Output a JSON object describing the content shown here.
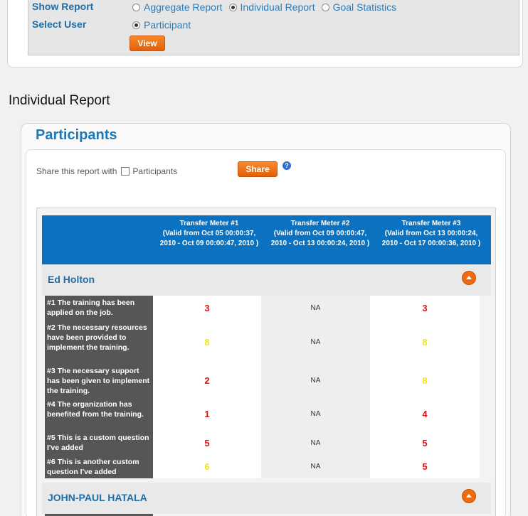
{
  "filters": {
    "show_report_label": "Show Report",
    "select_user_label": "Select User",
    "report_options": [
      {
        "label": "Aggregate Report",
        "checked": false
      },
      {
        "label": "Individual Report",
        "checked": true
      },
      {
        "label": "Goal Statistics",
        "checked": false
      }
    ],
    "user_options": [
      {
        "label": "Participant",
        "checked": true
      }
    ],
    "view_button": "View"
  },
  "report_title": "Individual Report",
  "panel": {
    "title": "Participants",
    "share_label": "Share this report with",
    "share_checkbox_label": "Participants",
    "share_button": "Share",
    "help_icon": "?"
  },
  "columns": [
    {
      "title": "Transfer Meter #1",
      "valid": "(Valid from Oct 05 00:00:37, 2010 - Oct 09 00:00:47, 2010 )"
    },
    {
      "title": "Transfer Meter #2",
      "valid": "(Valid from Oct 09 00:00:47, 2010 - Oct 13 00:00:24, 2010 )"
    },
    {
      "title": "Transfer Meter #3",
      "valid": "(Valid from Oct 13 00:00:24, 2010 - Oct 17 00:00:36, 2010 )"
    }
  ],
  "groups": [
    {
      "name": "Ed Holton",
      "questions": [
        {
          "label": "#1 The training has been applied on the job.",
          "values": [
            "3",
            "NA",
            "3"
          ],
          "colors": [
            "red",
            "na",
            "red"
          ]
        },
        {
          "label": "#2 The necessary resources have been provided to implement the training.",
          "values": [
            "8",
            "NA",
            "8"
          ],
          "colors": [
            "yellow",
            "na",
            "yellow"
          ]
        },
        {
          "label": "#3 The necessary support has been given to implement the training.",
          "values": [
            "2",
            "NA",
            "8"
          ],
          "colors": [
            "red",
            "na",
            "yellow"
          ]
        },
        {
          "label": "#4 The organization has benefited from the training.",
          "values": [
            "1",
            "NA",
            "4"
          ],
          "colors": [
            "red",
            "na",
            "red"
          ]
        },
        {
          "label": "#5 This is a custom question I've added",
          "values": [
            "5",
            "NA",
            "5"
          ],
          "colors": [
            "red",
            "na",
            "red"
          ]
        },
        {
          "label": "#6 This is another custom question I've added",
          "values": [
            "6",
            "NA",
            "5"
          ],
          "colors": [
            "yellow",
            "na",
            "red"
          ]
        }
      ]
    },
    {
      "name": "JOHN-PAUL HATALA",
      "questions": []
    }
  ],
  "colors": {
    "accent_blue": "#1e78b8",
    "header_blue": "#0a72c0",
    "button_orange": "#f07a1e",
    "value_red": "#e01010",
    "value_yellow": "#f2e414",
    "label_gray": "#565656"
  }
}
